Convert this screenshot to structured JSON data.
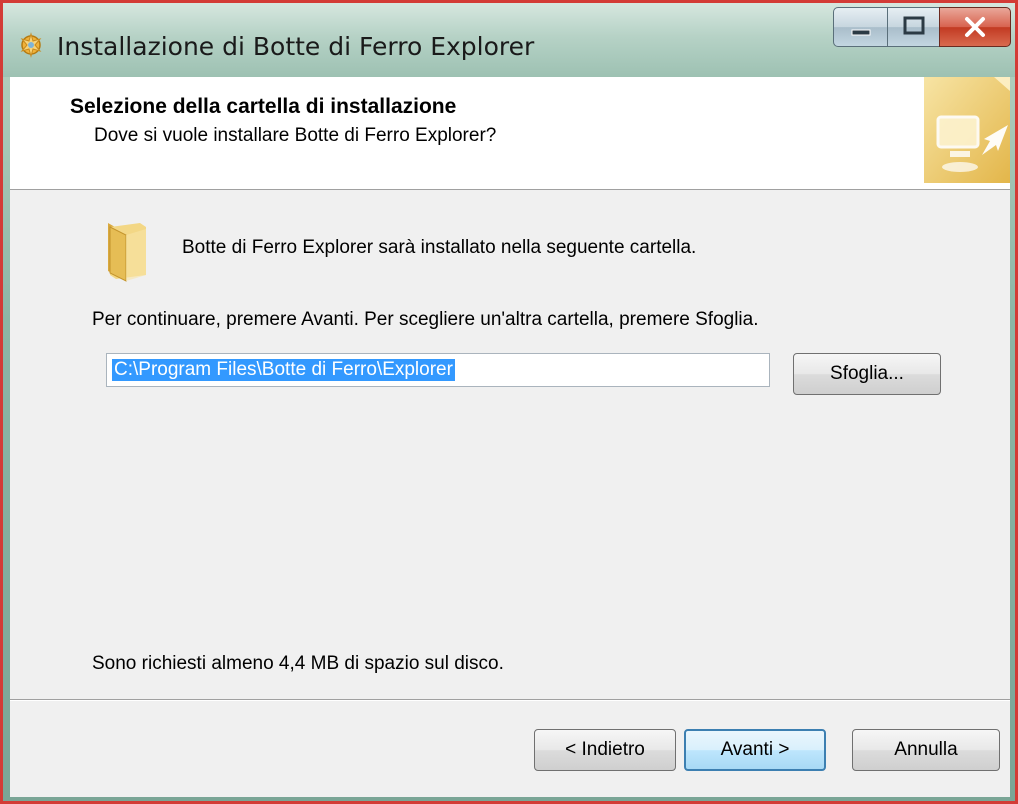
{
  "window": {
    "title": "Installazione di Botte di Ferro Explorer"
  },
  "header": {
    "title": "Selezione della cartella di installazione",
    "subtitle": "Dove si vuole installare Botte di Ferro Explorer?"
  },
  "body": {
    "install_line": "Botte di Ferro Explorer sarà installato nella seguente cartella.",
    "instruction": "Per continuare, premere Avanti. Per scegliere un'altra cartella, premere Sfoglia.",
    "path_value": "C:\\Program Files\\Botte di Ferro\\Explorer",
    "browse_label": "Sfoglia...",
    "space_required": "Sono richiesti almeno 4,4 MB di spazio sul disco."
  },
  "footer": {
    "back_label": "< Indietro",
    "next_label": "Avanti >",
    "cancel_label": "Annulla"
  },
  "icons": {
    "app": "installer-icon",
    "header": "monitor-arrow-icon",
    "folder": "folder-icon"
  },
  "colors": {
    "selection": "#3399ff",
    "default_button_border": "#3c7fb1",
    "close_button": "#c23a22"
  }
}
